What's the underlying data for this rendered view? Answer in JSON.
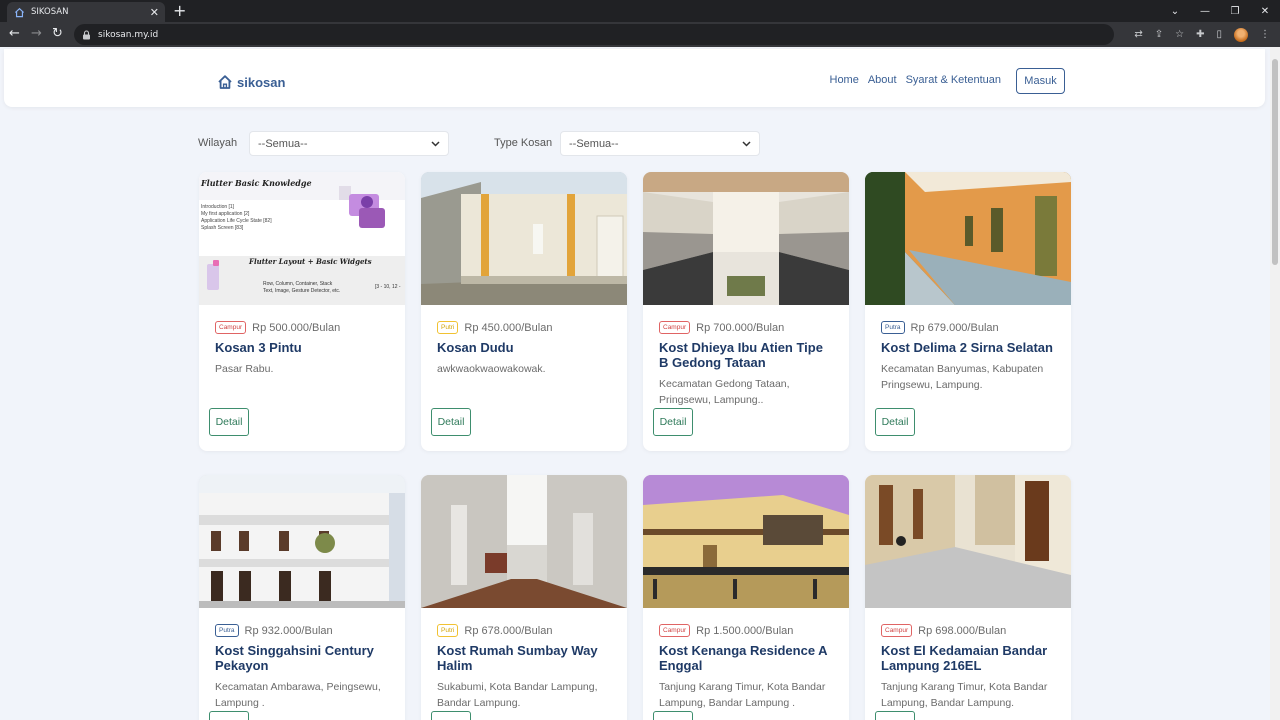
{
  "browser": {
    "tab_title": "SIKOSAN",
    "url": "sikosan.my.id"
  },
  "navbar": {
    "brand": "sikosan",
    "links": [
      "Home",
      "About",
      "Syarat & Ketentuan"
    ],
    "login_label": "Masuk"
  },
  "filters": {
    "wilayah_label": "Wilayah",
    "wilayah_value": "--Semua--",
    "type_label": "Type Kosan",
    "type_value": "--Semua--"
  },
  "detail_label": "Detail",
  "listings": [
    {
      "type": "Campur",
      "price": "Rp 500.000/Bulan",
      "name": "Kosan 3 Pintu",
      "address": "Pasar Rabu."
    },
    {
      "type": "Putri",
      "price": "Rp 450.000/Bulan",
      "name": "Kosan Dudu",
      "address": "awkwaokwaowakowak."
    },
    {
      "type": "Campur",
      "price": "Rp 700.000/Bulan",
      "name": "Kost Dhieya Ibu Atien Tipe B Gedong Tataan",
      "address": "Kecamatan Gedong Tataan, Pringsewu, Lampung.."
    },
    {
      "type": "Putra",
      "price": "Rp 679.000/Bulan",
      "name": "Kost Delima 2 Sirna Selatan",
      "address": "Kecamatan Banyumas, Kabupaten Pringsewu, Lampung."
    },
    {
      "type": "Putra",
      "price": "Rp 932.000/Bulan",
      "name": "Kost Singgahsini Century Pekayon",
      "address": "Kecamatan Ambarawa, Peingsewu, Lampung ."
    },
    {
      "type": "Putri",
      "price": "Rp 678.000/Bulan",
      "name": "Kost Rumah Sumbay Way Halim",
      "address": "Sukabumi, Kota Bandar Lampung, Bandar Lampung."
    },
    {
      "type": "Campur",
      "price": "Rp 1.500.000/Bulan",
      "name": "Kost Kenanga Residence A Enggal",
      "address": "Tanjung Karang Timur, Kota Bandar Lampung, Bandar Lampung ."
    },
    {
      "type": "Campur",
      "price": "Rp 698.000/Bulan",
      "name": "Kost El Kedamaian Bandar Lampung 216EL",
      "address": "Tanjung Karang Timur, Kota Bandar Lampung, Bandar Lampung."
    }
  ],
  "thumb1": {
    "heading1": "Flutter Basic Knowledge",
    "lines": [
      "Introduction [1]",
      "My first application [2]",
      "Application Life Cycle State [82]",
      "Splash Screen [83]"
    ],
    "heading2": "Flutter Layout + Basic Widgets",
    "bullets": [
      "Row, Column, Container, Stack",
      "Text, Image, Gesture Detector, etc."
    ],
    "range": "[3 - 10, 12 -"
  },
  "colors": {
    "brand": "#3a5f94",
    "campur": "#d04545",
    "putri": "#d4a60a",
    "putra": "#3a5f94",
    "detail": "#2f7a5a"
  }
}
